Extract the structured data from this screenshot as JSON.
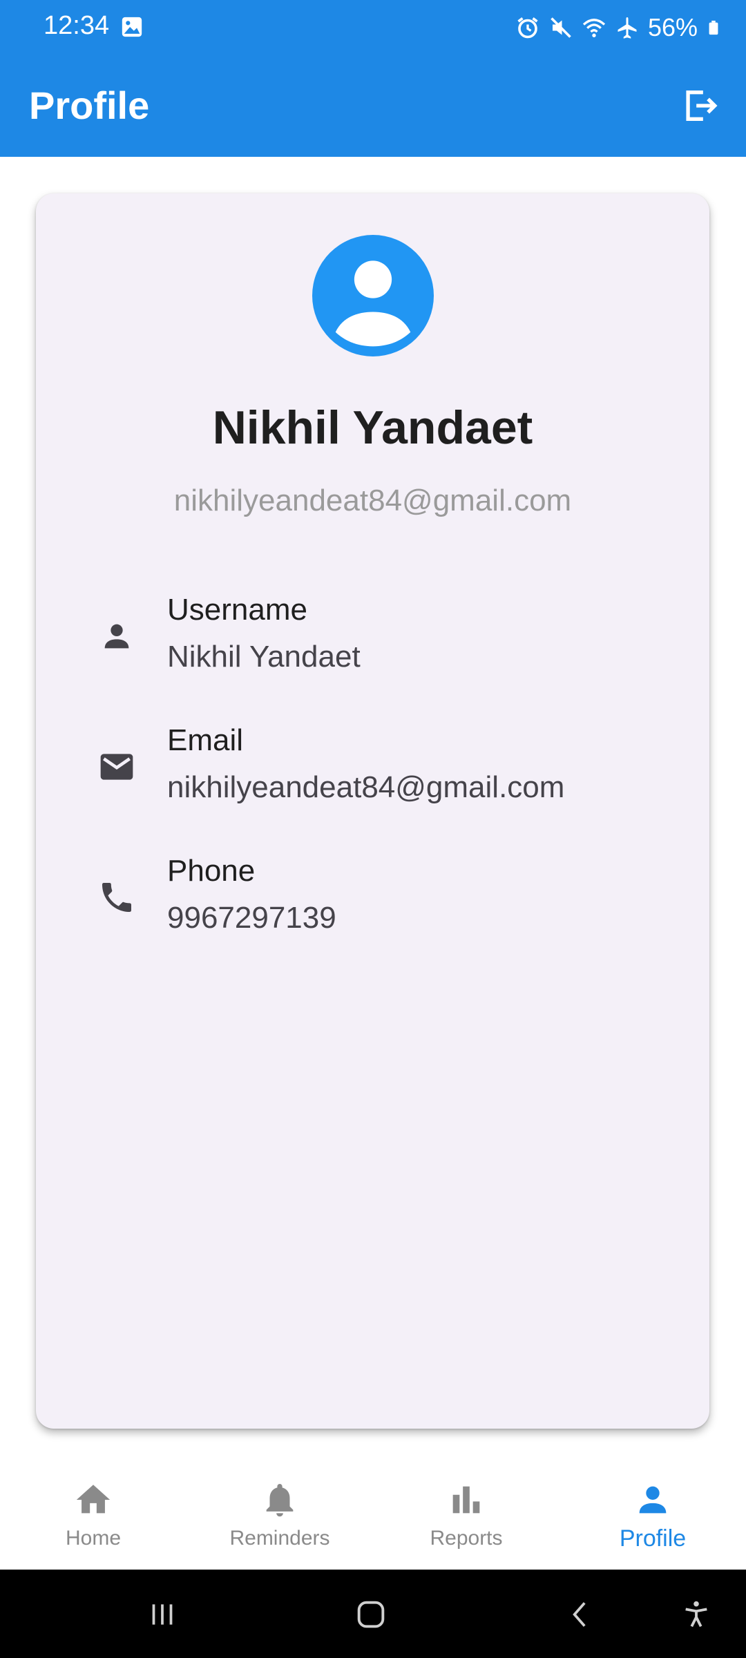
{
  "status_bar": {
    "time": "12:34",
    "battery": "56%"
  },
  "app_bar": {
    "title": "Profile",
    "action_icon": "logout-icon"
  },
  "profile": {
    "avatar_icon": "account-circle-icon",
    "name": "Nikhil Yandaet",
    "email": "nikhilyeandeat84@gmail.com"
  },
  "details": [
    {
      "icon": "person-icon",
      "label": "Username",
      "value": "Nikhil Yandaet"
    },
    {
      "icon": "mail-icon",
      "label": "Email",
      "value": "nikhilyeandeat84@gmail.com"
    },
    {
      "icon": "phone-icon",
      "label": "Phone",
      "value": "9967297139"
    }
  ],
  "bottom_nav": {
    "items": [
      {
        "label": "Home",
        "icon": "home-icon",
        "active": false
      },
      {
        "label": "Reminders",
        "icon": "bell-icon",
        "active": false
      },
      {
        "label": "Reports",
        "icon": "bar-chart-icon",
        "active": false
      },
      {
        "label": "Profile",
        "icon": "person-icon",
        "active": true
      }
    ]
  },
  "colors": {
    "primary": "#1e88e5",
    "card_background": "#f4f0f8",
    "inactive_nav": "#8a8a8a"
  }
}
